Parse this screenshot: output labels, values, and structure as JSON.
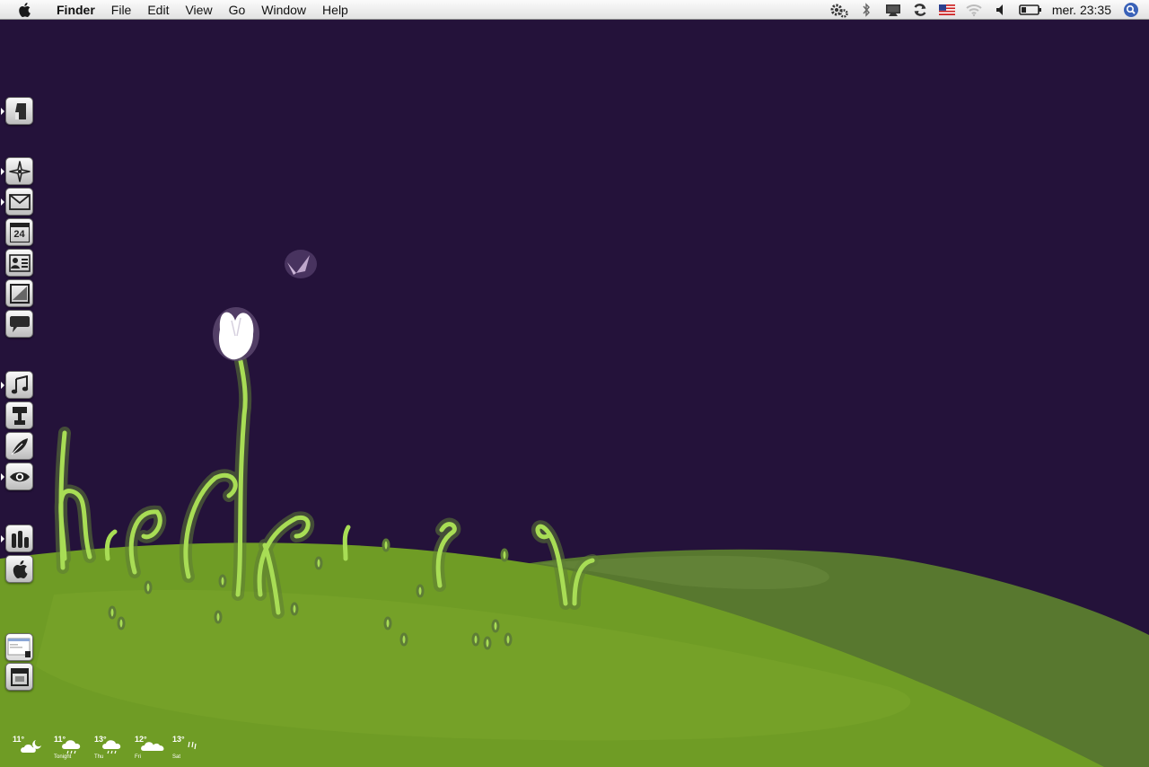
{
  "menubar": {
    "app_name": "Finder",
    "menus": [
      "File",
      "Edit",
      "View",
      "Go",
      "Window",
      "Help"
    ],
    "status_icons": [
      "gear-icon",
      "bluetooth-icon",
      "display-icon",
      "sync-icon",
      "us-flag-icon",
      "wifi-icon",
      "volume-icon",
      "battery-icon"
    ],
    "clock": "mer. 23:35",
    "spotlight_icon": "spotlight-icon"
  },
  "dock": {
    "position": "left",
    "items": [
      {
        "name": "finder",
        "icon": "finder-icon",
        "running": true
      },
      {
        "name": "safari",
        "icon": "compass-icon",
        "running": true
      },
      {
        "name": "mail",
        "icon": "mail-icon",
        "running": true
      },
      {
        "name": "ical",
        "icon": "calendar-icon",
        "label": "24",
        "running": false
      },
      {
        "name": "address-book",
        "icon": "address-book-icon",
        "running": false
      },
      {
        "name": "preview",
        "icon": "preview-icon",
        "running": false
      },
      {
        "name": "ichat",
        "icon": "chat-bubble-icon",
        "running": false
      },
      {
        "name": "itunes",
        "icon": "music-note-icon",
        "running": true
      },
      {
        "name": "automator",
        "icon": "lamp-icon",
        "running": false
      },
      {
        "name": "script-editor",
        "icon": "feather-icon",
        "running": false
      },
      {
        "name": "quick-look",
        "icon": "eye-icon",
        "running": true
      },
      {
        "name": "activity-monitor",
        "icon": "bar-chart-icon",
        "running": true
      },
      {
        "name": "system-preferences",
        "icon": "apple-icon",
        "running": false
      },
      {
        "name": "documents-stack",
        "icon": "document-stack-icon",
        "running": false
      },
      {
        "name": "trash",
        "icon": "trash-icon",
        "running": false
      }
    ]
  },
  "weather": {
    "days": [
      {
        "temp": "11°",
        "label": "",
        "icon": "partly-cloudy-night-icon"
      },
      {
        "temp": "11°",
        "label": "Tonight",
        "icon": "rain-cloud-icon"
      },
      {
        "temp": "13°",
        "label": "Thu",
        "icon": "rain-cloud-icon"
      },
      {
        "temp": "12°",
        "label": "Fri",
        "icon": "cloudy-icon"
      },
      {
        "temp": "13°",
        "label": "Sat",
        "icon": "rain-icon"
      }
    ]
  },
  "colors": {
    "sky": "#24123a",
    "hill_light": "#6e9a26",
    "hill_dark": "#58782f",
    "plant_glow": "#b8e86a"
  }
}
